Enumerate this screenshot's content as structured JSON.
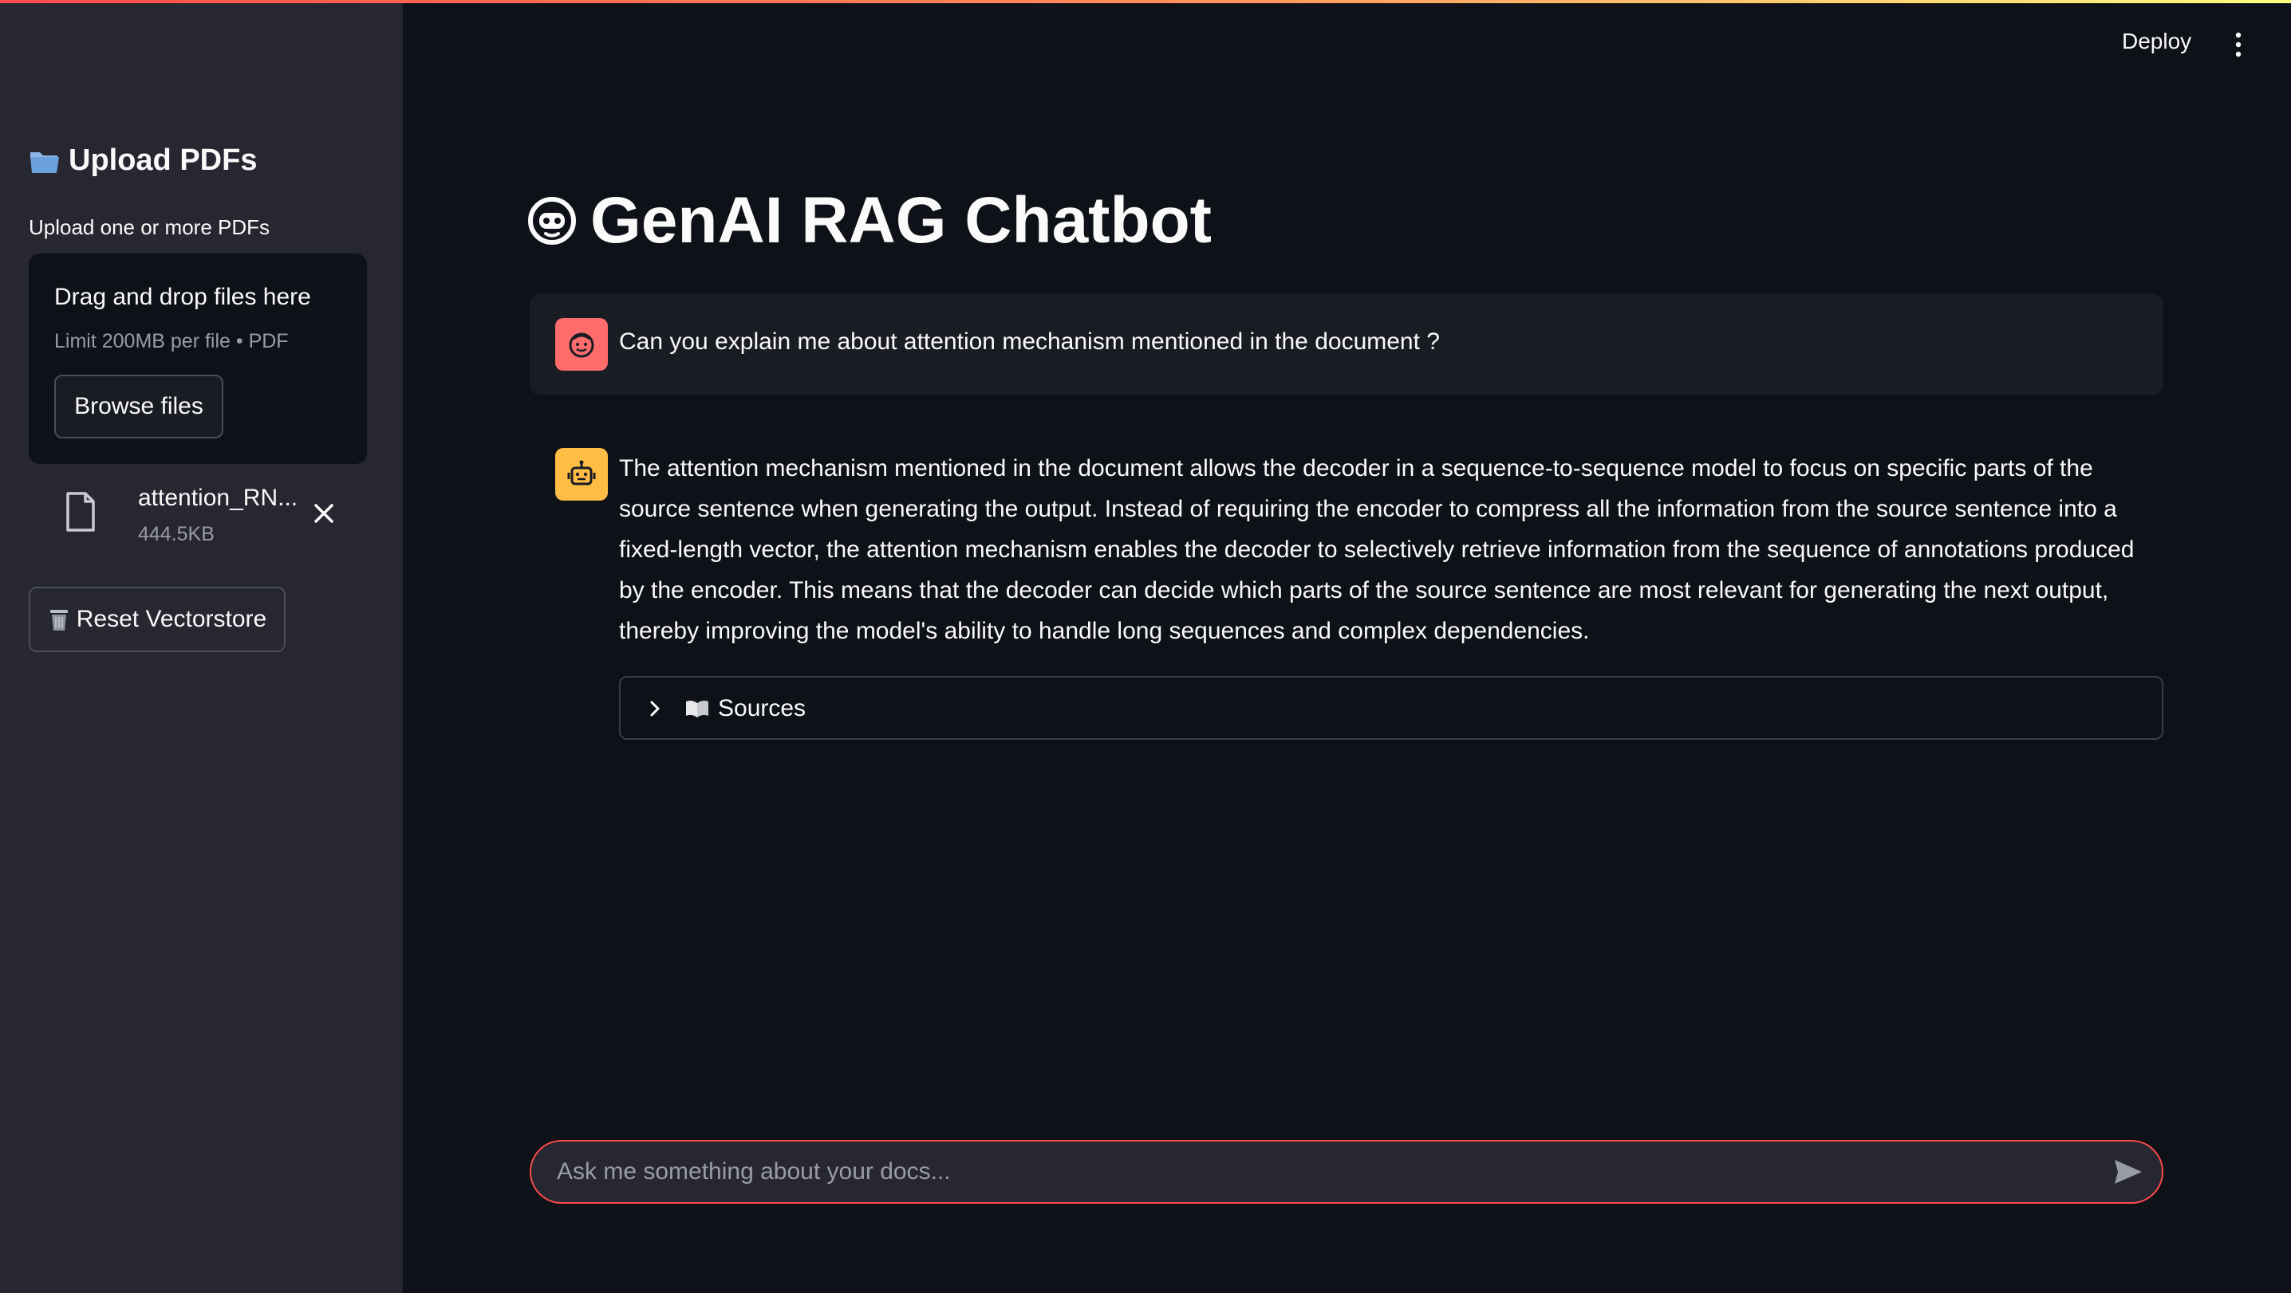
{
  "header": {
    "deploy_label": "Deploy",
    "menu_icon": "more-vertical-icon"
  },
  "sidebar": {
    "heading": "Upload PDFs",
    "heading_icon": "folder-icon",
    "uploader_label": "Upload one or more PDFs",
    "dropzone": {
      "title": "Drag and drop files here",
      "limit": "Limit 200MB per file • PDF",
      "browse_label": "Browse files"
    },
    "files": [
      {
        "name": "attention_RN...",
        "size": "444.5KB"
      }
    ],
    "reset_label": "Reset Vectorstore",
    "reset_icon": "trash-icon"
  },
  "main": {
    "title": "GenAI RAG Chatbot",
    "title_icon": "robot-face-icon",
    "messages": [
      {
        "role": "user",
        "avatar": "user-face-icon",
        "text": "Can you explain me about attention mechanism mentioned in the document ?"
      },
      {
        "role": "assistant",
        "avatar": "robot-icon",
        "text": "The attention mechanism mentioned in the document allows the decoder in a sequence-to-sequence model to focus on specific parts of the source sentence when generating the output. Instead of requiring the encoder to compress all the information from the source sentence into a fixed-length vector, the attention mechanism enables the decoder to selectively retrieve information from the sequence of annotations produced by the encoder. This means that the decoder can decide which parts of the source sentence are most relevant for generating the next output, thereby improving the model's ability to handle long sequences and complex dependencies.",
        "sources_label": "Sources"
      }
    ],
    "chat_input": {
      "placeholder": "Ask me something about your docs...",
      "value": ""
    }
  },
  "colors": {
    "accent": "#ff4b4b",
    "background": "#0e1117",
    "sidebar": "#262730",
    "user_avatar": "#ff6c6c",
    "bot_avatar": "#ffbd45"
  }
}
